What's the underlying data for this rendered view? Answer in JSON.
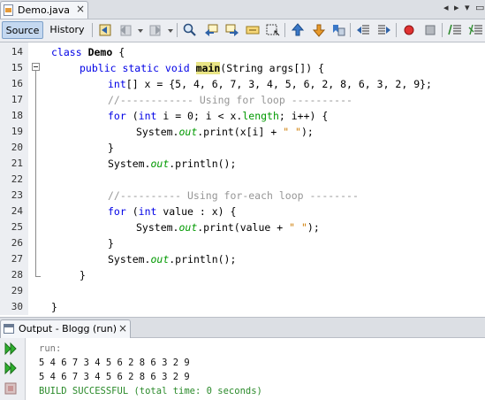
{
  "editor_tab": {
    "filename": "Demo.java",
    "close_glyph": "×",
    "left_arrow": "◂",
    "right_arrow": "▸",
    "dropdown_arrow": "▾",
    "restore_glyph": "▭"
  },
  "toolbar": {
    "source_label": "Source",
    "history_label": "History",
    "icons": [
      "last-edit-icon",
      "back-icon",
      "back-dropdown-icon",
      "forward-icon",
      "forward-dropdown-icon",
      "find-icon",
      "find-previous-icon",
      "find-next-icon",
      "toggle-highlight-icon",
      "toggle-rect-select-icon",
      "previous-bookmark-icon",
      "next-bookmark-icon",
      "toggle-bookmark-icon",
      "shift-left-icon",
      "shift-right-icon",
      "start-macro-icon",
      "stop-macro-icon",
      "comment-icon",
      "uncomment-icon"
    ]
  },
  "code": {
    "line_numbers": [
      "14",
      "15",
      "16",
      "17",
      "18",
      "19",
      "20",
      "21",
      "22",
      "23",
      "24",
      "25",
      "26",
      "27",
      "28",
      "29",
      "30"
    ],
    "l14": {
      "kw": "class",
      "name": "Demo",
      "rest": " {"
    },
    "l15": {
      "kw": "public static void",
      "name": "main",
      "rest": "(String args[]) {"
    },
    "l16": {
      "kw": "int",
      "rest": "[] x = {5, 4, 6, 7, 3, 4, 5, 6, 2, 8, 6, 3, 2, 9};"
    },
    "l17": {
      "comment": "//------------ Using for loop ----------"
    },
    "l18": {
      "kw1": "for",
      "p1": " (",
      "kw2": "int",
      "p2": " i = 0; i < x.",
      "field": "length",
      "p3": "; i++) {"
    },
    "l19": {
      "p1": "System.",
      "field": "out",
      "p2": ".print(x[i] + ",
      "str": "\" \"",
      "p3": ");"
    },
    "l20": {
      "text": "}"
    },
    "l21": {
      "p1": "System.",
      "field": "out",
      "p2": ".println();"
    },
    "l23": {
      "comment": "//---------- Using for-each loop --------"
    },
    "l24": {
      "kw1": "for",
      "p1": " (",
      "kw2": "int",
      "p2": " value : x) {"
    },
    "l25": {
      "p1": "System.",
      "field": "out",
      "p2": ".print(value + ",
      "str": "\" \"",
      "p3": ");"
    },
    "l26": {
      "text": "}"
    },
    "l27": {
      "p1": "System.",
      "field": "out",
      "p2": ".println();"
    },
    "l28": {
      "text": "}"
    },
    "l30": {
      "text": "}"
    }
  },
  "output": {
    "tab_title": "Output - Blogg (run)",
    "close_glyph": "×",
    "lines": [
      "run:",
      "5 4 6 7 3 4 5 6 2 8 6 3 2 9",
      "5 4 6 7 3 4 5 6 2 8 6 3 2 9",
      "BUILD SUCCESSFUL (total time: 0 seconds)"
    ],
    "side_icons": [
      "rerun-icon",
      "rerun-with-options-icon",
      "stop-icon"
    ]
  }
}
